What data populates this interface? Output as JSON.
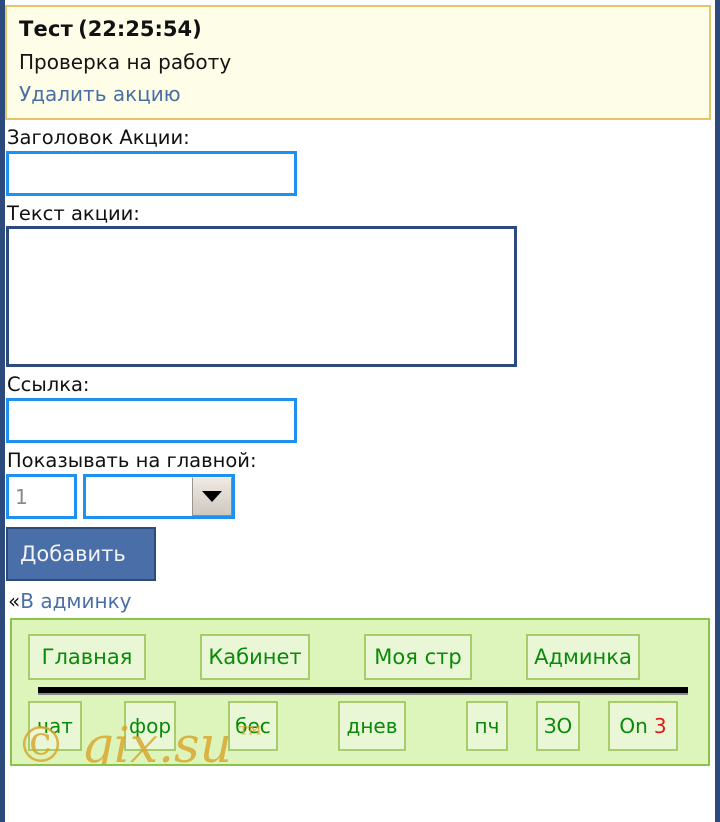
{
  "announcement": {
    "title": "Тест",
    "time": "(22:25:54)",
    "body": "Проверка на работу",
    "delete_link": "Удалить акцию",
    "bg_color": "#fdfde8",
    "border_color": "#e8c468",
    "link_color": "#4a6fa5"
  },
  "form": {
    "title_label": "Заголовок Акции:",
    "title_value": "",
    "title_placeholder": "",
    "text_label": "Текст акции:",
    "text_value": "",
    "text_placeholder": "",
    "link_label": "Ссылка:",
    "link_value": "",
    "link_placeholder": "",
    "show_main_label": "Показывать на главной:",
    "number_value": "1",
    "number_placeholder": "1",
    "select_value": "",
    "select_options": [
      ""
    ],
    "submit_label": "Добавить",
    "focus_border_color": "#1e90f0",
    "textarea_border_color": "#2d4a7c",
    "submit_bg_color": "#4a6ea8"
  },
  "admin": {
    "prefix": "«",
    "link_label": "В админку"
  },
  "nav": {
    "bg_color": "#ddf5bb",
    "border_color": "#8bc34a",
    "button_bg": "#e9f7d6",
    "button_border": "#a8cc6a",
    "text_color": "#0a8a0a",
    "row1": [
      {
        "label": "Главная"
      },
      {
        "label": "Кабинет"
      },
      {
        "label": "Моя стр"
      },
      {
        "label": "Админка"
      }
    ],
    "row2": [
      {
        "label": "чат"
      },
      {
        "label": "фор"
      },
      {
        "label": "бес"
      },
      {
        "label": "днев"
      },
      {
        "label": "пч"
      },
      {
        "label": "ЗО"
      }
    ],
    "online": {
      "label": "On",
      "count": "3",
      "label_color": "#0a8a0a",
      "count_color": "#e01b1b"
    }
  },
  "watermark": {
    "text": "© gix.su",
    "tm": "™",
    "color": "#d9a830"
  }
}
